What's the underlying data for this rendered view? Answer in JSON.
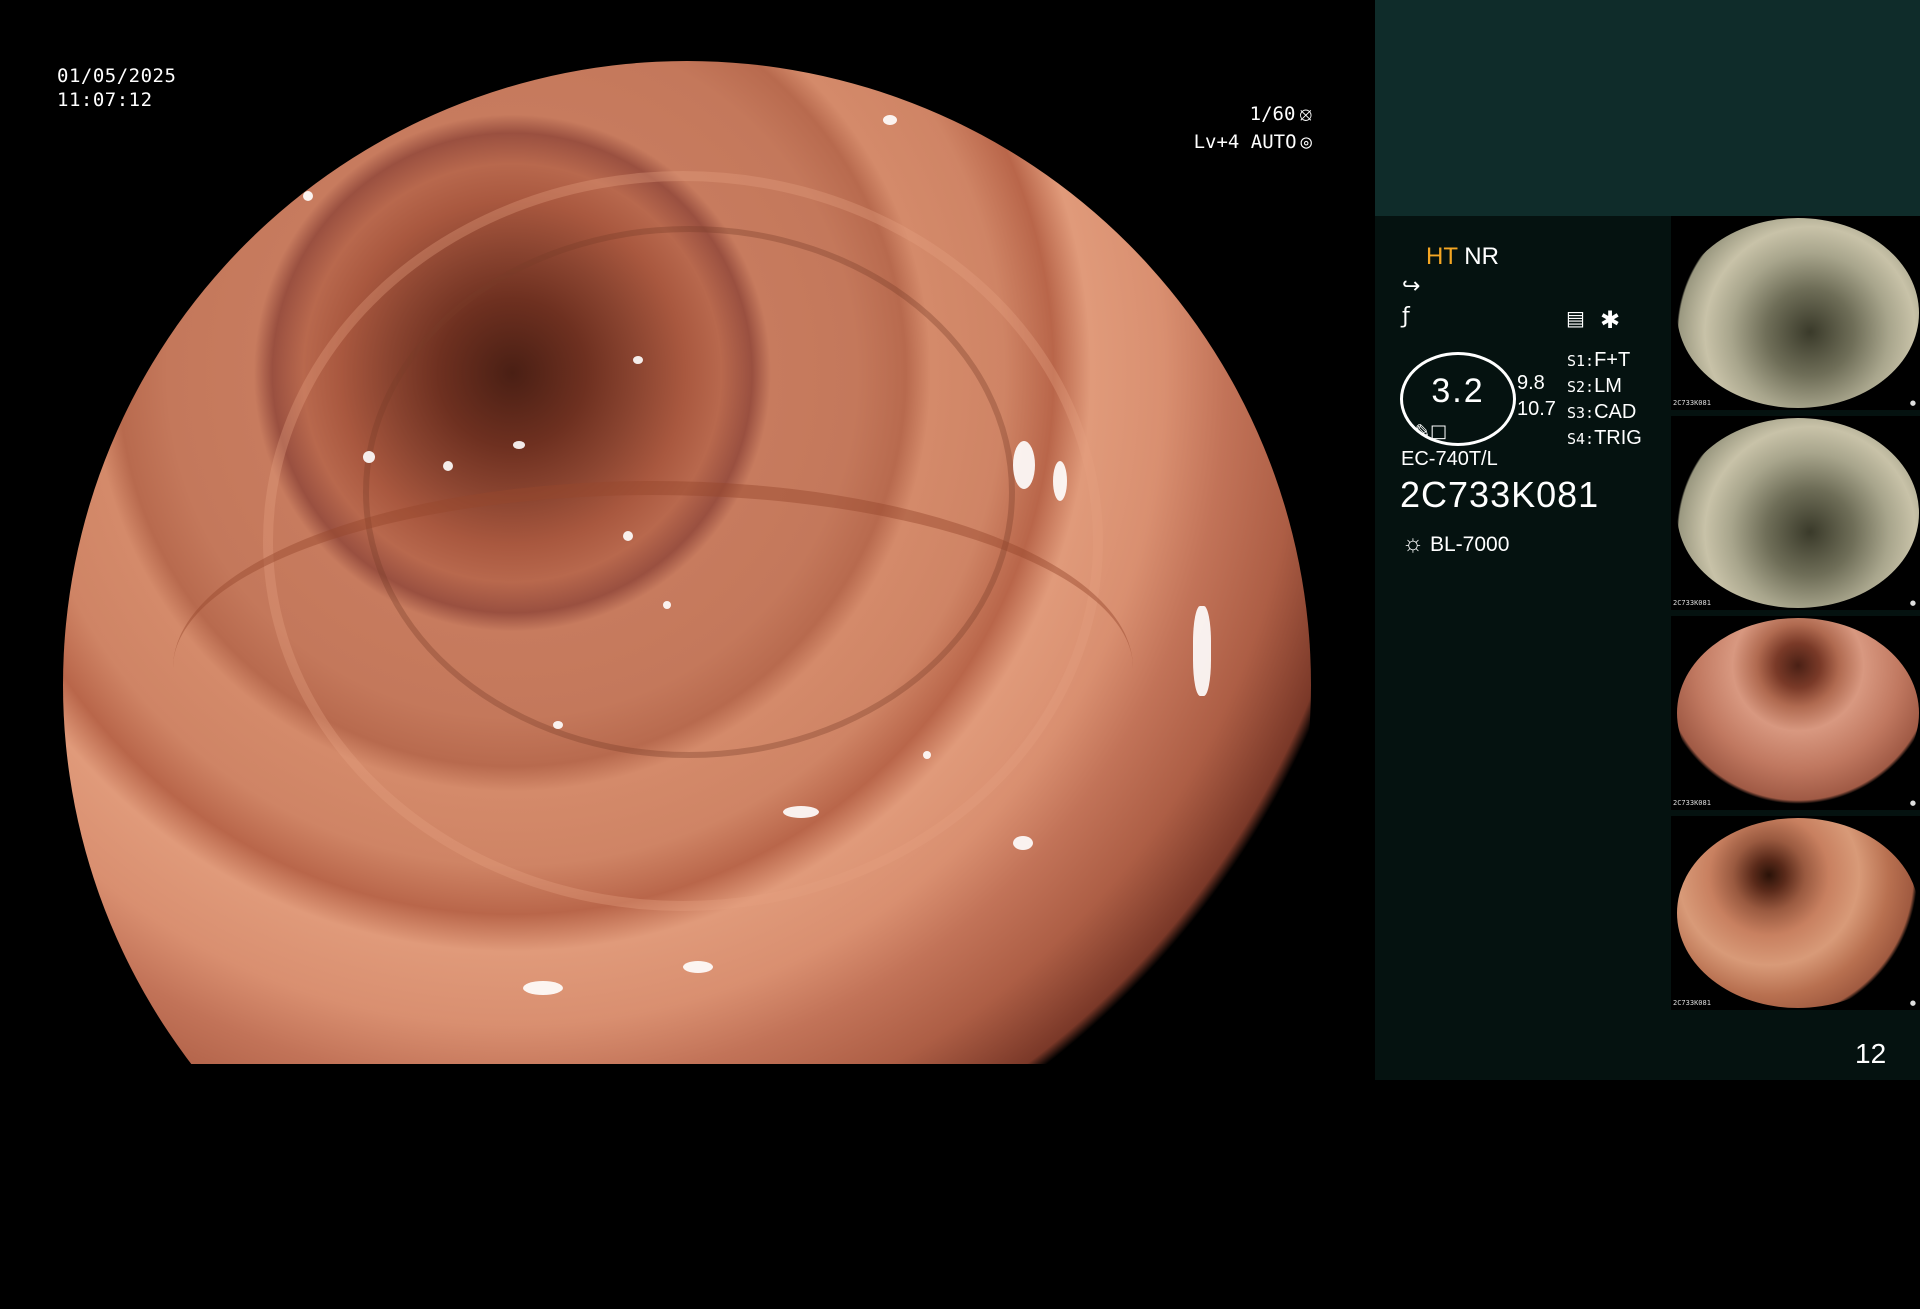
{
  "overlay": {
    "date": "01/05/2025",
    "time": "11:07:12",
    "shutter": "1/60",
    "level": "Lv+4 AUTO"
  },
  "panel": {
    "ht": "HT",
    "nr": "NR",
    "gauge_value": "3.2",
    "gauge_nums": [
      "9.8",
      "10.7"
    ],
    "slots": [
      {
        "key": "S1:",
        "value": "F+T"
      },
      {
        "key": "S2:",
        "value": "LM"
      },
      {
        "key": "S3:",
        "value": "CAD"
      },
      {
        "key": "S4:",
        "value": "TRIG"
      }
    ],
    "model": "EC-740T/L",
    "serial": "2C733K081",
    "light_source": "BL-7000",
    "page_number": "12"
  },
  "thumbnails": [
    {
      "label": "2C733K081",
      "tone": "greenish"
    },
    {
      "label": "2C733K081",
      "tone": "greenish"
    },
    {
      "label": "2C733K081",
      "tone": "pink"
    },
    {
      "label": "2C733K081",
      "tone": "pink"
    }
  ],
  "colors": {
    "highlight": "#f5a623",
    "panel_top": "#0f2c2a",
    "panel": "#051210"
  }
}
